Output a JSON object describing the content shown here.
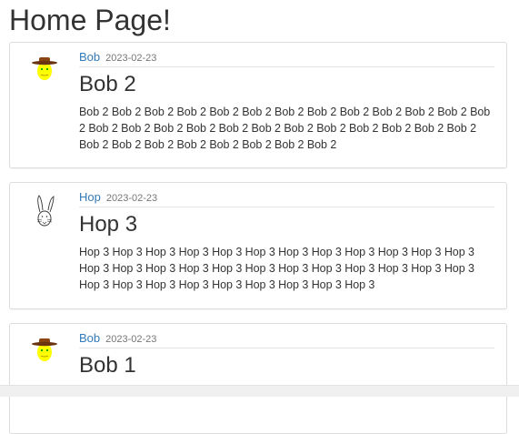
{
  "page": {
    "title": "Home Page!"
  },
  "posts": [
    {
      "author": "Bob",
      "date": "2023-02-23",
      "title": "Bob 2",
      "body": "Bob 2 Bob 2 Bob 2 Bob 2 Bob 2 Bob 2 Bob 2 Bob 2 Bob 2 Bob 2 Bob 2 Bob 2 Bob 2 Bob 2 Bob 2 Bob 2 Bob 2 Bob 2 Bob 2 Bob 2 Bob 2 Bob 2 Bob 2 Bob 2 Bob 2 Bob 2 Bob 2 Bob 2 Bob 2 Bob 2 Bob 2 Bob 2 Bob 2",
      "avatar_icon": "cowboy-face-icon"
    },
    {
      "author": "Hop",
      "date": "2023-02-23",
      "title": "Hop 3",
      "body": "Hop 3 Hop 3 Hop 3 Hop 3 Hop 3 Hop 3 Hop 3 Hop 3 Hop 3 Hop 3 Hop 3 Hop 3 Hop 3 Hop 3 Hop 3 Hop 3 Hop 3 Hop 3 Hop 3 Hop 3 Hop 3 Hop 3 Hop 3 Hop 3 Hop 3 Hop 3 Hop 3 Hop 3 Hop 3 Hop 3 Hop 3 Hop 3 Hop 3",
      "avatar_icon": "bunny-icon"
    },
    {
      "author": "Bob",
      "date": "2023-02-23",
      "title": "Bob 1",
      "body": "",
      "avatar_icon": "cowboy-face-icon"
    }
  ],
  "colors": {
    "link": "#337ab7",
    "text": "#333333",
    "muted": "#777777",
    "border": "#dddddd"
  }
}
